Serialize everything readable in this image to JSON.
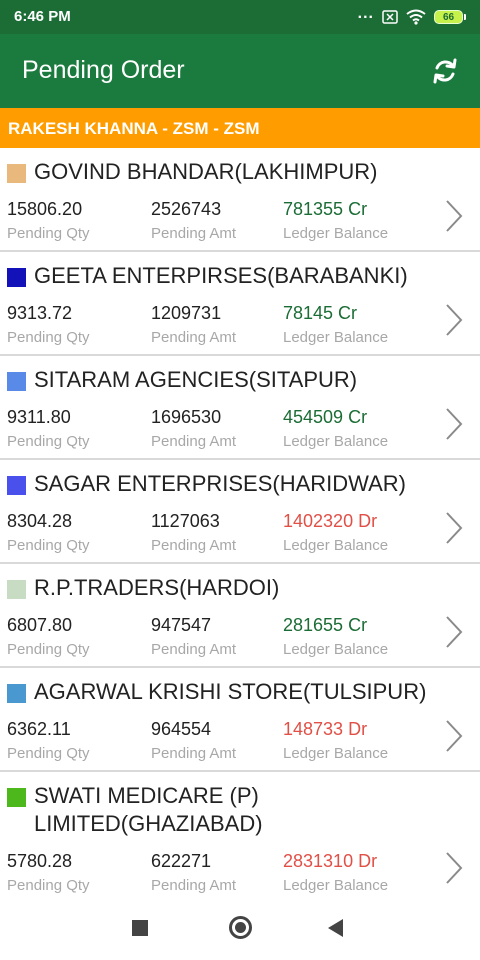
{
  "status_bar": {
    "time": "6:46 PM",
    "dots": "...",
    "battery_level": "66"
  },
  "app_bar": {
    "title": "Pending Order",
    "refresh_icon": "refresh-icon"
  },
  "user_strip": {
    "text": "RAKESH KHANNA - ZSM - ZSM"
  },
  "labels": {
    "qty": "Pending Qty",
    "amt": "Pending Amt",
    "balance": "Ledger Balance"
  },
  "orders": [
    {
      "name": "GOVIND BHANDAR(LAKHIMPUR)",
      "color": "#e8b87c",
      "qty": "15806.20",
      "amt": "2526743",
      "balance": "781355 Cr",
      "balance_type": "Cr"
    },
    {
      "name": "GEETA ENTERPIRSES(BARABANKI)",
      "color": "#1212b8",
      "qty": "9313.72",
      "amt": "1209731",
      "balance": "78145 Cr",
      "balance_type": "Cr"
    },
    {
      "name": "SITARAM AGENCIES(SITAPUR)",
      "color": "#5a8ae8",
      "qty": "9311.80",
      "amt": "1696530",
      "balance": "454509 Cr",
      "balance_type": "Cr"
    },
    {
      "name": "SAGAR ENTERPRISES(HARIDWAR)",
      "color": "#4a50ec",
      "qty": "8304.28",
      "amt": "1127063",
      "balance": "1402320 Dr",
      "balance_type": "Dr"
    },
    {
      "name": "R.P.TRADERS(HARDOI)",
      "color": "#c8dcc4",
      "qty": "6807.80",
      "amt": "947547",
      "balance": "281655 Cr",
      "balance_type": "Cr"
    },
    {
      "name": "AGARWAL KRISHI STORE(TULSIPUR)",
      "color": "#4a98d0",
      "qty": "6362.11",
      "amt": "964554",
      "balance": "148733 Dr",
      "balance_type": "Dr"
    },
    {
      "name": "SWATI MEDICARE (P) LIMITED(GHAZIABAD)",
      "color": "#4cb81c",
      "qty": "5780.28",
      "amt": "622271",
      "balance": "2831310 Dr",
      "balance_type": "Dr"
    }
  ],
  "nav_bar": {
    "recents": "recents-icon",
    "home": "home-icon",
    "back": "back-icon"
  }
}
